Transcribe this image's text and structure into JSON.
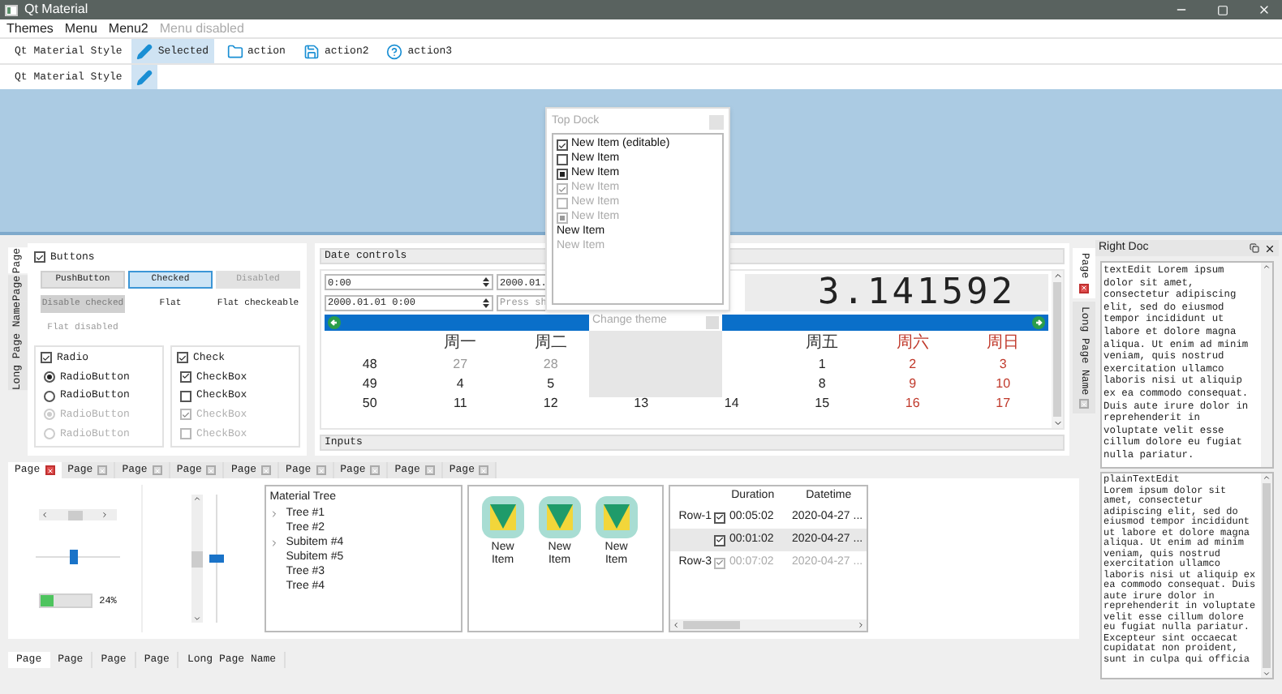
{
  "window": {
    "title": "Qt Material"
  },
  "menu": [
    {
      "label": "Themes",
      "disabled": false
    },
    {
      "label": "Menu",
      "disabled": false
    },
    {
      "label": "Menu2",
      "disabled": false
    },
    {
      "label": "Menu disabled",
      "disabled": true
    }
  ],
  "toolbars": [
    {
      "label": "Qt Material Style",
      "actions": [
        {
          "label": "Selected",
          "kind": "pencil",
          "selected": true
        },
        {
          "label": "action",
          "kind": "folder",
          "selected": false
        },
        {
          "label": "action2",
          "kind": "save",
          "selected": false
        },
        {
          "label": "action3",
          "kind": "help",
          "selected": false
        }
      ]
    },
    {
      "label": "Qt Material Style",
      "actions": [
        {
          "kind": "pencil",
          "selected": true
        }
      ]
    }
  ],
  "top_dock": {
    "title": "Top Dock",
    "items": [
      {
        "label": "New Item (editable)",
        "kind": "check",
        "checked": true,
        "disabled": false
      },
      {
        "label": "New Item",
        "kind": "check",
        "checked": false,
        "disabled": false
      },
      {
        "label": "New Item",
        "kind": "partial",
        "disabled": false
      },
      {
        "label": "New Item",
        "kind": "check",
        "checked": true,
        "disabled": true
      },
      {
        "label": "New Item",
        "kind": "check",
        "checked": false,
        "disabled": true
      },
      {
        "label": "New Item",
        "kind": "partial",
        "disabled": true
      },
      {
        "label": "New Item",
        "kind": "plain",
        "disabled": false
      },
      {
        "label": "New Item",
        "kind": "plain",
        "disabled": true
      }
    ]
  },
  "left_tabs": [
    {
      "label": "Page",
      "selected": true
    },
    {
      "label": "Page",
      "selected": false
    },
    {
      "label": "Long Page Name",
      "selected": false
    }
  ],
  "buttons_group": {
    "title": "Buttons",
    "checked": true,
    "buttons": [
      {
        "label": "PushButton",
        "kind": "push",
        "checked": false,
        "disabled": false
      },
      {
        "label": "Checked",
        "kind": "push",
        "checked": true,
        "disabled": false
      },
      {
        "label": "Disabled",
        "kind": "push",
        "checked": false,
        "disabled": true
      },
      {
        "label": "Disable checked",
        "kind": "push",
        "checked": true,
        "disabled": true
      },
      {
        "label": "Flat",
        "kind": "flat",
        "disabled": false
      },
      {
        "label": "Flat checkeable",
        "kind": "flat",
        "disabled": false
      },
      {
        "label": "Flat disabled",
        "kind": "flat",
        "disabled": true
      }
    ]
  },
  "radio_group": {
    "title": "Radio",
    "checked": true,
    "items": [
      {
        "label": "RadioButton",
        "selected": true,
        "disabled": false
      },
      {
        "label": "RadioButton",
        "selected": false,
        "disabled": false
      },
      {
        "label": "RadioButton",
        "selected": true,
        "disabled": true
      },
      {
        "label": "RadioButton",
        "selected": false,
        "disabled": true
      }
    ]
  },
  "check_group": {
    "title": "Check",
    "checked": true,
    "items": [
      {
        "label": "CheckBox",
        "checked": true,
        "disabled": false
      },
      {
        "label": "CheckBox",
        "checked": false,
        "disabled": false
      },
      {
        "label": "CheckBox",
        "checked": true,
        "disabled": true
      },
      {
        "label": "CheckBox",
        "checked": false,
        "disabled": true
      }
    ]
  },
  "date_controls": {
    "title": "Date controls",
    "fields": [
      {
        "value": "0:00"
      },
      {
        "value": "2000.01."
      },
      {
        "value": "2000.01.01 0:00"
      },
      {
        "placeholder": "Press sh"
      }
    ],
    "lcd": "3.141592",
    "popup_label": "Change theme",
    "weekdays": [
      {
        "label": "周一",
        "weekend": false
      },
      {
        "label": "周二",
        "weekend": false
      },
      {
        "label": "周五",
        "weekend": false
      },
      {
        "label": "周六",
        "weekend": true
      },
      {
        "label": "周日",
        "weekend": true
      }
    ],
    "weeks": [
      {
        "number": "48",
        "days": [
          {
            "text": "27",
            "kind": "other"
          },
          {
            "text": "28",
            "kind": "other"
          },
          {
            "text": "1",
            "kind": "weekday"
          },
          {
            "text": "2",
            "kind": "weekend"
          },
          {
            "text": "3",
            "kind": "weekend"
          }
        ]
      },
      {
        "number": "49",
        "days": [
          {
            "text": "4",
            "kind": "weekday"
          },
          {
            "text": "5",
            "kind": "weekday"
          },
          {
            "text": "8",
            "kind": "weekday"
          },
          {
            "text": "9",
            "kind": "weekend"
          },
          {
            "text": "10",
            "kind": "weekend"
          }
        ]
      },
      {
        "number": "50",
        "days": [
          {
            "text": "11",
            "kind": "weekday"
          },
          {
            "text": "12",
            "kind": "weekday"
          },
          {
            "text": "13",
            "kind": "weekday"
          },
          {
            "text": "14",
            "kind": "weekday"
          },
          {
            "text": "15",
            "kind": "weekday"
          },
          {
            "text": "16",
            "kind": "weekend"
          },
          {
            "text": "17",
            "kind": "weekend"
          }
        ]
      }
    ],
    "inputs_title": "Inputs"
  },
  "right_tabs": [
    {
      "label": "Page",
      "selected": true
    },
    {
      "label": "Long Page Name",
      "selected": false
    }
  ],
  "bottom_tabs": [
    {
      "label": "Page",
      "selected": true
    },
    {
      "label": "Page",
      "selected": false
    },
    {
      "label": "Page",
      "selected": false
    },
    {
      "label": "Page",
      "selected": false
    },
    {
      "label": "Page",
      "selected": false
    },
    {
      "label": "Page",
      "selected": false
    },
    {
      "label": "Page",
      "selected": false
    },
    {
      "label": "Page",
      "selected": false
    },
    {
      "label": "Page",
      "selected": false
    }
  ],
  "horizontal_slider": {
    "level": 0.45
  },
  "vertical_slider": {
    "level": 0.5
  },
  "progress": {
    "level": 0.24,
    "text": "24%"
  },
  "tree": {
    "header": "Material Tree",
    "items": [
      {
        "label": "Tree #1",
        "expandable": true
      },
      {
        "label": "Tree #2",
        "expandable": false
      },
      {
        "label": "Subitem #4",
        "expandable": true
      },
      {
        "label": "Subitem #5",
        "expandable": false
      },
      {
        "label": "Tree #3",
        "expandable": false
      },
      {
        "label": "Tree #4",
        "expandable": false
      }
    ]
  },
  "icon_list": [
    {
      "label": "New Item"
    },
    {
      "label": "New Item"
    },
    {
      "label": "New Item"
    }
  ],
  "table": {
    "columns": [
      "Duration",
      "Datetime"
    ],
    "rows": [
      {
        "header": "Row-1",
        "checked": true,
        "disabled": false,
        "selected": false,
        "duration": "00:05:02",
        "datetime": "2020-04-27 ..."
      },
      {
        "checked": true,
        "disabled": false,
        "selected": true,
        "duration": "00:01:02",
        "datetime": "2020-04-27 ..."
      },
      {
        "header": "Row-3",
        "checked": true,
        "disabled": true,
        "selected": false,
        "duration": "00:07:02",
        "datetime": "2020-04-27 ..."
      }
    ]
  },
  "bottom_page_tabs": [
    {
      "label": "Page",
      "selected": true
    },
    {
      "label": "Page",
      "selected": false
    },
    {
      "label": "Page",
      "selected": false
    },
    {
      "label": "Page",
      "selected": false
    },
    {
      "label": "Long Page Name",
      "selected": false
    }
  ],
  "right_doc": {
    "title": "Right Doc",
    "text_edit": "textEdit Lorem ipsum dolor sit amet, consectetur adipiscing elit, sed do eiusmod tempor incididunt ut labore et dolore magna aliqua. Ut enim ad minim veniam, quis nostrud exercitation ullamco laboris nisi ut aliquip ex ea commodo consequat. Duis aute irure dolor in reprehenderit in voluptate velit esse cillum dolore eu fugiat nulla pariatur.",
    "plain_text_edit": "plainTextEdit\nLorem ipsum dolor sit amet, consectetur adipiscing elit, sed do eiusmod tempor incididunt ut labore et dolore magna aliqua. Ut enim ad minim veniam, quis nostrud exercitation ullamco laboris nisi ut aliquip ex ea commodo consequat. Duis aute irure dolor in reprehenderit in voluptate velit esse cillum dolore eu fugiat nulla pariatur. Excepteur sint occaecat cupidatat non proident, sunt in culpa qui officia"
  }
}
